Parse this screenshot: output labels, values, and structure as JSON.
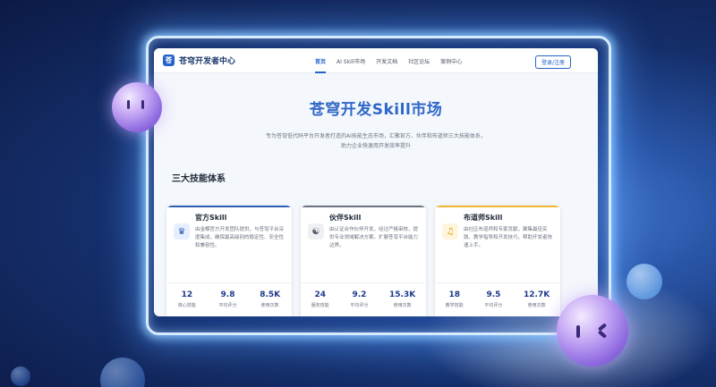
{
  "nav": {
    "logo_glyph": "苍",
    "brand": "苍穹开发者中心",
    "links": [
      {
        "label": "首页",
        "active": true
      },
      {
        "label": "AI Skill市场",
        "active": false
      },
      {
        "label": "开发文档",
        "active": false
      },
      {
        "label": "社区论坛",
        "active": false
      },
      {
        "label": "案例中心",
        "active": false
      }
    ],
    "login_label": "登录/注册"
  },
  "hero": {
    "title": "苍穹开发Skill市场",
    "description": "专为苍穹低代码平台开发者打造的AI技能生态市场，汇聚官方、伙伴和布道师三大技能体系，助力企业快速用开发效率提升"
  },
  "section_title": "三大技能体系",
  "cards": [
    {
      "title": "官方Skill",
      "description": "由金蝶官方开发团队提供，与苍穹平台深度集成，确保最高级别的稳定性、安全性和兼容性。",
      "icon": "crown-icon",
      "icon_glyph": "♛",
      "accent": "#2f5fb3",
      "stats": [
        {
          "value": "12",
          "label": "核心技能"
        },
        {
          "value": "9.8",
          "label": "平均评分"
        },
        {
          "value": "8.5K",
          "label": "使用次数"
        }
      ]
    },
    {
      "title": "伙伴Skill",
      "description": "由认证合作伙伴开发，经过严格审核，提供专业领域解决方案，扩展苍穹平台能力边界。",
      "icon": "handshake-icon",
      "icon_glyph": "☯",
      "accent": "#6b7280",
      "stats": [
        {
          "value": "24",
          "label": "服务技能"
        },
        {
          "value": "9.2",
          "label": "平均评分"
        },
        {
          "value": "15.3K",
          "label": "使用次数"
        }
      ]
    },
    {
      "title": "布道师Skill",
      "description": "由社区布道师和专家贡献，聚集最佳实践、教学指导和开发技巧，帮助开发者快速上手。",
      "icon": "megaphone-icon",
      "icon_glyph": "♫",
      "accent": "#f2b632",
      "stats": [
        {
          "value": "18",
          "label": "教学技能"
        },
        {
          "value": "9.5",
          "label": "平均评分"
        },
        {
          "value": "12.7K",
          "label": "使用次数"
        }
      ]
    }
  ]
}
